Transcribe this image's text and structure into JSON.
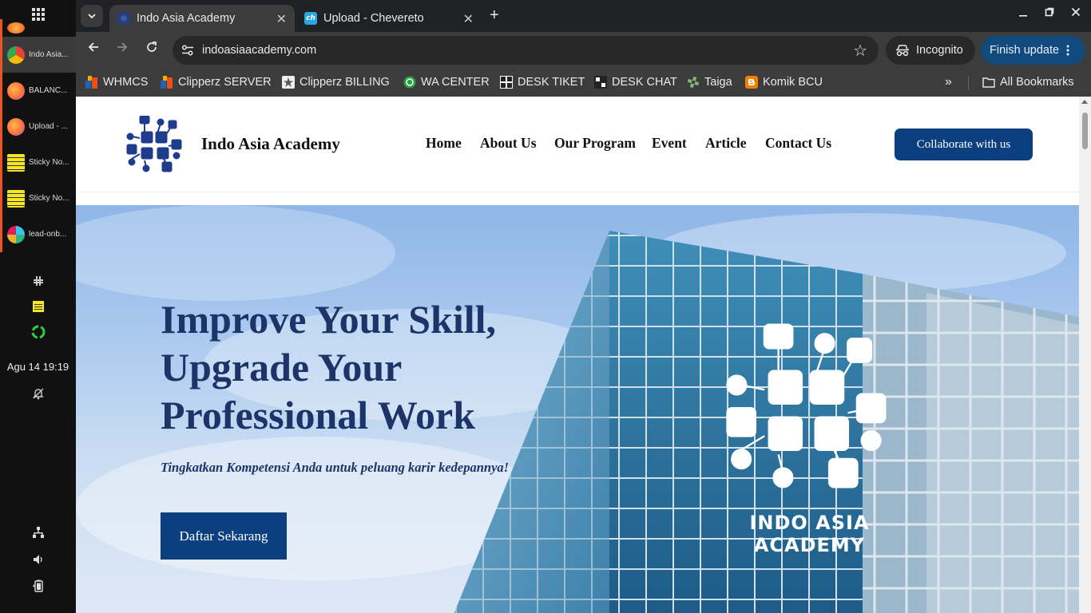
{
  "desktop": {
    "tasks": [
      {
        "label": "",
        "color": "#e95420"
      },
      {
        "label": "Indo Asia...",
        "color": "#4285f4"
      },
      {
        "label": "BALANC...",
        "color": "#ff7139"
      },
      {
        "label": "Upload - ...",
        "color": "#ff7139"
      },
      {
        "label": "Sticky No...",
        "color": "#f5e625"
      },
      {
        "label": "Sticky No...",
        "color": "#f5e625"
      },
      {
        "label": "lead-onb...",
        "color": "#e01e5a"
      }
    ],
    "clock": "Agu 14  19:19"
  },
  "browser": {
    "tabs": [
      {
        "title": "Indo Asia Academy",
        "active": true
      },
      {
        "title": "Upload - Chevereto",
        "active": false
      }
    ],
    "url": "indoasiaacademy.com",
    "incognito_label": "Incognito",
    "update_label": "Finish update",
    "bookmarks": [
      {
        "label": "WHMCS",
        "icon": "whmcs-icon"
      },
      {
        "label": "Clipperz SERVER",
        "icon": "clipperz-icon"
      },
      {
        "label": "Clipperz BILLING",
        "icon": "clipperz-billing-icon"
      },
      {
        "label": "WA CENTER",
        "icon": "whatsapp-icon"
      },
      {
        "label": "DESK TIKET",
        "icon": "desk-icon"
      },
      {
        "label": "DESK CHAT",
        "icon": "desk-chat-icon"
      },
      {
        "label": "Taiga",
        "icon": "taiga-icon"
      },
      {
        "label": "Komik BCU",
        "icon": "blogger-icon"
      }
    ],
    "all_bookmarks_label": "All Bookmarks"
  },
  "site": {
    "brand": "Indo Asia Academy",
    "nav": [
      "Home",
      "About Us",
      "Our Program",
      "Event",
      "Article",
      "Contact Us"
    ],
    "cta": "Collaborate with us",
    "hero": {
      "title_line1": "Improve Your Skill,",
      "title_line2": "Upgrade Your",
      "title_line3": "Professional Work",
      "subtitle": "Tingkatkan Kompetensi Anda untuk peluang karir kedepannya!",
      "button": "Daftar Sekarang",
      "wordmark": "INDO ASIA ACADEMY"
    },
    "colors": {
      "primary": "#0b3f80",
      "heading": "#1d3469"
    }
  }
}
